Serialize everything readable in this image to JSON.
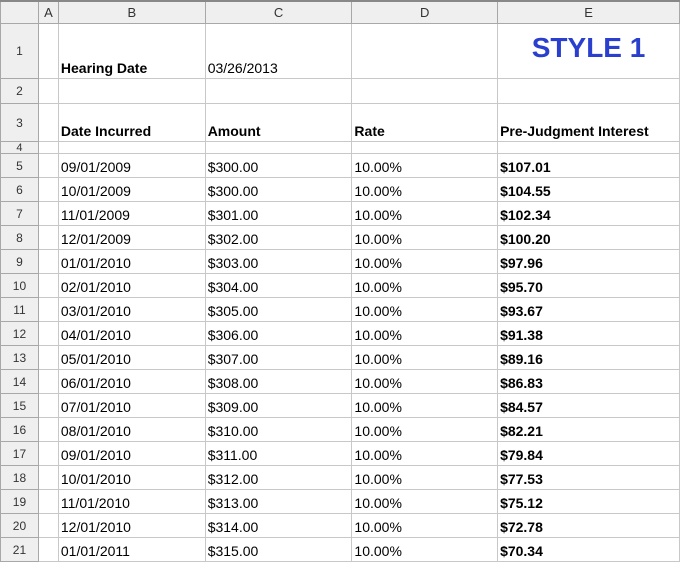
{
  "columns": [
    "A",
    "B",
    "C",
    "D",
    "E"
  ],
  "header": {
    "hearing_label": "Hearing Date",
    "hearing_date": "03/26/2013",
    "style_label": "STYLE 1",
    "col_date": "Date Incurred",
    "col_amount": "Amount",
    "col_rate": "Rate",
    "col_interest": "Pre-Judgment Interest"
  },
  "row_numbers": [
    "1",
    "2",
    "3",
    "4"
  ],
  "rows": [
    {
      "n": "5",
      "date": "09/01/2009",
      "amount": "$300.00",
      "rate": "10.00%",
      "interest": "$107.01"
    },
    {
      "n": "6",
      "date": "10/01/2009",
      "amount": "$300.00",
      "rate": "10.00%",
      "interest": "$104.55"
    },
    {
      "n": "7",
      "date": "11/01/2009",
      "amount": "$301.00",
      "rate": "10.00%",
      "interest": "$102.34"
    },
    {
      "n": "8",
      "date": "12/01/2009",
      "amount": "$302.00",
      "rate": "10.00%",
      "interest": "$100.20"
    },
    {
      "n": "9",
      "date": "01/01/2010",
      "amount": "$303.00",
      "rate": "10.00%",
      "interest": "$97.96"
    },
    {
      "n": "10",
      "date": "02/01/2010",
      "amount": "$304.00",
      "rate": "10.00%",
      "interest": "$95.70"
    },
    {
      "n": "11",
      "date": "03/01/2010",
      "amount": "$305.00",
      "rate": "10.00%",
      "interest": "$93.67"
    },
    {
      "n": "12",
      "date": "04/01/2010",
      "amount": "$306.00",
      "rate": "10.00%",
      "interest": "$91.38"
    },
    {
      "n": "13",
      "date": "05/01/2010",
      "amount": "$307.00",
      "rate": "10.00%",
      "interest": "$89.16"
    },
    {
      "n": "14",
      "date": "06/01/2010",
      "amount": "$308.00",
      "rate": "10.00%",
      "interest": "$86.83"
    },
    {
      "n": "15",
      "date": "07/01/2010",
      "amount": "$309.00",
      "rate": "10.00%",
      "interest": "$84.57"
    },
    {
      "n": "16",
      "date": "08/01/2010",
      "amount": "$310.00",
      "rate": "10.00%",
      "interest": "$82.21"
    },
    {
      "n": "17",
      "date": "09/01/2010",
      "amount": "$311.00",
      "rate": "10.00%",
      "interest": "$79.84"
    },
    {
      "n": "18",
      "date": "10/01/2010",
      "amount": "$312.00",
      "rate": "10.00%",
      "interest": "$77.53"
    },
    {
      "n": "19",
      "date": "11/01/2010",
      "amount": "$313.00",
      "rate": "10.00%",
      "interest": "$75.12"
    },
    {
      "n": "20",
      "date": "12/01/2010",
      "amount": "$314.00",
      "rate": "10.00%",
      "interest": "$72.78"
    },
    {
      "n": "21",
      "date": "01/01/2011",
      "amount": "$315.00",
      "rate": "10.00%",
      "interest": "$70.34"
    }
  ]
}
